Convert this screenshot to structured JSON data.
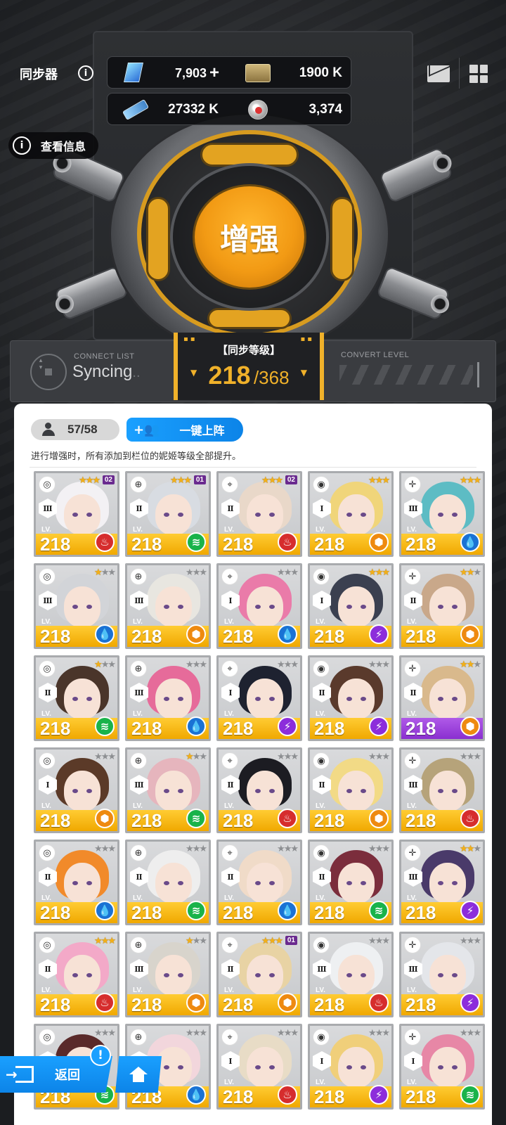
{
  "header": {
    "title": "同步器",
    "view_info": "查看信息"
  },
  "resources": {
    "gems": "7,903",
    "gems_plus": "+",
    "credits": "1900 K",
    "battle_data": "27332 K",
    "core_dust": "3,374"
  },
  "center_button": "增强",
  "status": {
    "connect_label": "CONNECT LIST",
    "syncing": "Syncing",
    "syncing_dots": "..",
    "level_label": "【同步等级】",
    "level_current": "218",
    "level_max": "/368",
    "convert_label": "CONVERT LEVEL"
  },
  "panel": {
    "count": "57/58",
    "auto_button": "一键上阵",
    "hint": "进行增强时，所有添加到栏位的妮姬等级全部提升。"
  },
  "card_level_label": "LV.",
  "nikkes": [
    {
      "burst": "Ⅲ",
      "level": "218",
      "element": "fire",
      "stars": 3,
      "core": "02",
      "hair": "#f3f1f4",
      "bar": "yellow"
    },
    {
      "burst": "Ⅱ",
      "level": "218",
      "element": "wind",
      "stars": 3,
      "core": "01",
      "hair": "#d8dce2",
      "bar": "yellow"
    },
    {
      "burst": "Ⅱ",
      "level": "218",
      "element": "fire",
      "stars": 3,
      "core": "02",
      "hair": "#e9d8c9",
      "bar": "yellow"
    },
    {
      "burst": "Ⅰ",
      "level": "218",
      "element": "iron",
      "stars": 3,
      "core": "",
      "hair": "#f0d57a",
      "bar": "yellow"
    },
    {
      "burst": "Ⅲ",
      "level": "218",
      "element": "water",
      "stars": 3,
      "core": "",
      "hair": "#5dbcc4",
      "bar": "yellow"
    },
    {
      "burst": "Ⅲ",
      "level": "218",
      "element": "water",
      "stars": 1,
      "core": "",
      "hair": "#d2d4d8",
      "bar": "yellow"
    },
    {
      "burst": "Ⅲ",
      "level": "218",
      "element": "iron",
      "stars": 0,
      "core": "",
      "hair": "#e8e6e0",
      "bar": "yellow"
    },
    {
      "burst": "Ⅰ",
      "level": "218",
      "element": "water",
      "stars": 0,
      "core": "",
      "hair": "#ea7ba9",
      "bar": "yellow"
    },
    {
      "burst": "Ⅰ",
      "level": "218",
      "element": "electric",
      "stars": 3,
      "core": "",
      "hair": "#3b4050",
      "bar": "yellow"
    },
    {
      "burst": "Ⅱ",
      "level": "218",
      "element": "iron",
      "stars": 2,
      "core": "",
      "hair": "#c9a88a",
      "bar": "yellow"
    },
    {
      "burst": "Ⅱ",
      "level": "218",
      "element": "wind",
      "stars": 1,
      "core": "",
      "hair": "#4a352a",
      "bar": "yellow"
    },
    {
      "burst": "Ⅲ",
      "level": "218",
      "element": "water",
      "stars": 0,
      "core": "",
      "hair": "#e66b9a",
      "bar": "yellow"
    },
    {
      "burst": "Ⅰ",
      "level": "218",
      "element": "electric",
      "stars": 0,
      "core": "",
      "hair": "#1e2230",
      "bar": "yellow"
    },
    {
      "burst": "Ⅱ",
      "level": "218",
      "element": "electric",
      "stars": 0,
      "core": "",
      "hair": "#5a3a2c",
      "bar": "yellow"
    },
    {
      "burst": "Ⅱ",
      "level": "218",
      "element": "iron",
      "stars": 2,
      "core": "",
      "hair": "#d9b98c",
      "bar": "purple"
    },
    {
      "burst": "Ⅰ",
      "level": "218",
      "element": "iron",
      "stars": 0,
      "core": "",
      "hair": "#5b3a28",
      "bar": "yellow"
    },
    {
      "burst": "Ⅲ",
      "level": "218",
      "element": "wind",
      "stars": 1,
      "core": "",
      "hair": "#e6b5bd",
      "bar": "yellow"
    },
    {
      "burst": "Ⅱ",
      "level": "218",
      "element": "fire",
      "stars": 0,
      "core": "",
      "hair": "#1c1c22",
      "bar": "yellow"
    },
    {
      "burst": "Ⅱ",
      "level": "218",
      "element": "iron",
      "stars": 0,
      "core": "",
      "hair": "#f2da86",
      "bar": "yellow"
    },
    {
      "burst": "Ⅲ",
      "level": "218",
      "element": "fire",
      "stars": 0,
      "core": "",
      "hair": "#b6a37a",
      "bar": "yellow"
    },
    {
      "burst": "Ⅱ",
      "level": "218",
      "element": "water",
      "stars": 0,
      "core": "",
      "hair": "#f18a2a",
      "bar": "yellow"
    },
    {
      "burst": "Ⅱ",
      "level": "218",
      "element": "wind",
      "stars": 0,
      "core": "",
      "hair": "#eeeeee",
      "bar": "yellow"
    },
    {
      "burst": "Ⅱ",
      "level": "218",
      "element": "water",
      "stars": 0,
      "core": "",
      "hair": "#f0dbc8",
      "bar": "yellow"
    },
    {
      "burst": "Ⅱ",
      "level": "218",
      "element": "wind",
      "stars": 0,
      "core": "",
      "hair": "#7b2d3c",
      "bar": "yellow"
    },
    {
      "burst": "Ⅲ",
      "level": "218",
      "element": "electric",
      "stars": 2,
      "core": "",
      "hair": "#4a3a6a",
      "bar": "yellow"
    },
    {
      "burst": "Ⅱ",
      "level": "218",
      "element": "fire",
      "stars": 3,
      "core": "",
      "hair": "#f3a9c8",
      "bar": "yellow"
    },
    {
      "burst": "Ⅲ",
      "level": "218",
      "element": "iron",
      "stars": 1,
      "core": "",
      "hair": "#d8d4cc",
      "bar": "yellow"
    },
    {
      "burst": "Ⅱ",
      "level": "218",
      "element": "iron",
      "stars": 3,
      "core": "01",
      "hair": "#e8d3a4",
      "bar": "yellow"
    },
    {
      "burst": "Ⅲ",
      "level": "218",
      "element": "fire",
      "stars": 0,
      "core": "",
      "hair": "#eef0f2",
      "bar": "yellow"
    },
    {
      "burst": "Ⅲ",
      "level": "218",
      "element": "electric",
      "stars": 0,
      "core": "",
      "hair": "#e4e6ea",
      "bar": "yellow"
    },
    {
      "burst": "Ⅱ",
      "level": "218",
      "element": "wind",
      "stars": 0,
      "core": "",
      "hair": "#5a2a2a",
      "bar": "yellow"
    },
    {
      "burst": "Ⅱ",
      "level": "218",
      "element": "water",
      "stars": 0,
      "core": "",
      "hair": "#f2d6dc",
      "bar": "yellow"
    },
    {
      "burst": "Ⅰ",
      "level": "218",
      "element": "fire",
      "stars": 0,
      "core": "",
      "hair": "#e8dcc6",
      "bar": "yellow"
    },
    {
      "burst": "Ⅰ",
      "level": "218",
      "element": "electric",
      "stars": 0,
      "core": "",
      "hair": "#f0cf7a",
      "bar": "yellow"
    },
    {
      "burst": "Ⅰ",
      "level": "218",
      "element": "wind",
      "stars": 0,
      "core": "",
      "hair": "#e787a6",
      "bar": "yellow"
    }
  ],
  "footer": {
    "back": "返回",
    "badge": "!"
  }
}
